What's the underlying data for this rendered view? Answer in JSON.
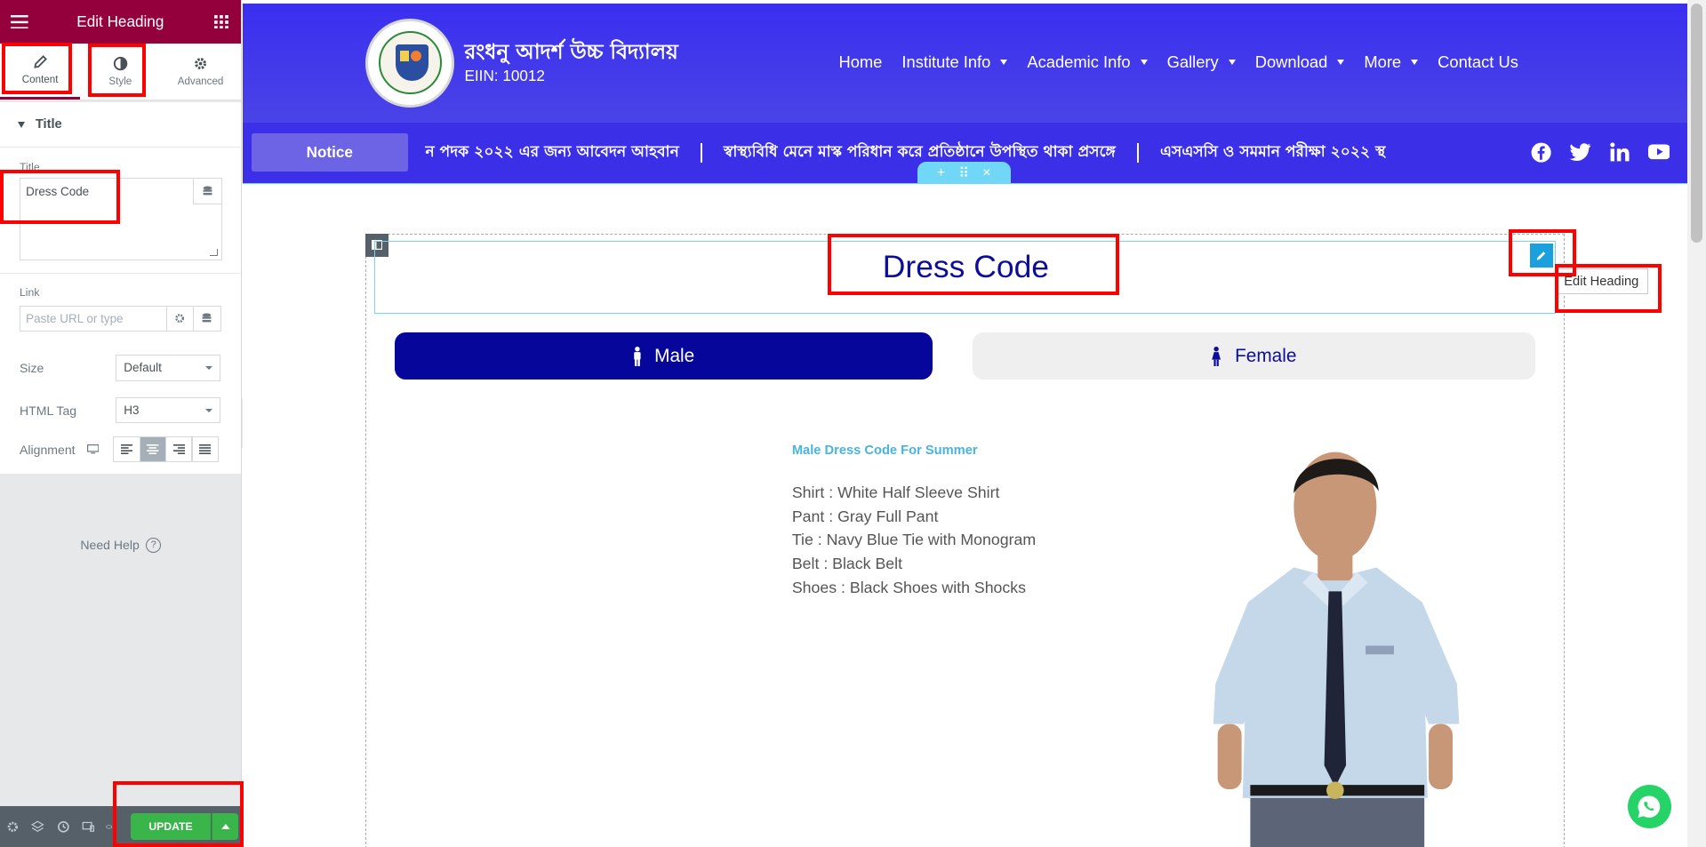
{
  "editor": {
    "header_title": "Edit Heading",
    "tabs": [
      {
        "label": "Content",
        "icon": "pencil-icon"
      },
      {
        "label": "Style",
        "icon": "half-circle-icon"
      },
      {
        "label": "Advanced",
        "icon": "gear-icon"
      }
    ],
    "section_title": "Title",
    "title_label": "Title",
    "title_value": "Dress Code",
    "link_label": "Link",
    "link_placeholder": "Paste URL or type",
    "size_label": "Size",
    "size_value": "Default",
    "html_tag_label": "HTML Tag",
    "html_tag_value": "H3",
    "alignment_label": "Alignment",
    "need_help": "Need Help",
    "update_label": "UPDATE",
    "accent_color": "#93003c"
  },
  "site": {
    "school_name": "রংধনু আদর্শ উচ্চ বিদ্যালয়",
    "eiin": "EIIN: 10012",
    "nav": [
      {
        "label": "Home",
        "dropdown": false
      },
      {
        "label": "Institute Info",
        "dropdown": true
      },
      {
        "label": "Academic Info",
        "dropdown": true
      },
      {
        "label": "Gallery",
        "dropdown": true
      },
      {
        "label": "Download",
        "dropdown": true
      },
      {
        "label": "More",
        "dropdown": true
      },
      {
        "label": "Contact Us",
        "dropdown": false
      }
    ],
    "notice_label": "Notice",
    "ticker": [
      "ন পদক ২০২২ এর জন্য আবেদন আহবান",
      "স্বাস্থ্যবিধি মেনে মাস্ক পরিধান করে প্রতিষ্ঠানে উপস্থিত থাকা প্রসঙ্গে",
      "এসএসসি ও সমমান পরীক্ষা ২০২২ স্থ"
    ],
    "socials": [
      "facebook-icon",
      "twitter-icon",
      "linkedin-icon",
      "youtube-icon"
    ],
    "heading": "Dress Code",
    "edit_tooltip": "Edit Heading",
    "tab_male": "Male",
    "tab_female": "Female",
    "dress_subtitle": "Male Dress Code For Summer",
    "dress_items": [
      "Shirt : White Half Sleeve Shirt",
      "Pant : Gray Full Pant",
      "Tie : Navy Blue Tie with Monogram",
      "Belt : Black Belt",
      "Shoes : Black Shoes with Shocks"
    ],
    "header_color": "#3a2ff0",
    "male_tab_color": "#07069a"
  }
}
